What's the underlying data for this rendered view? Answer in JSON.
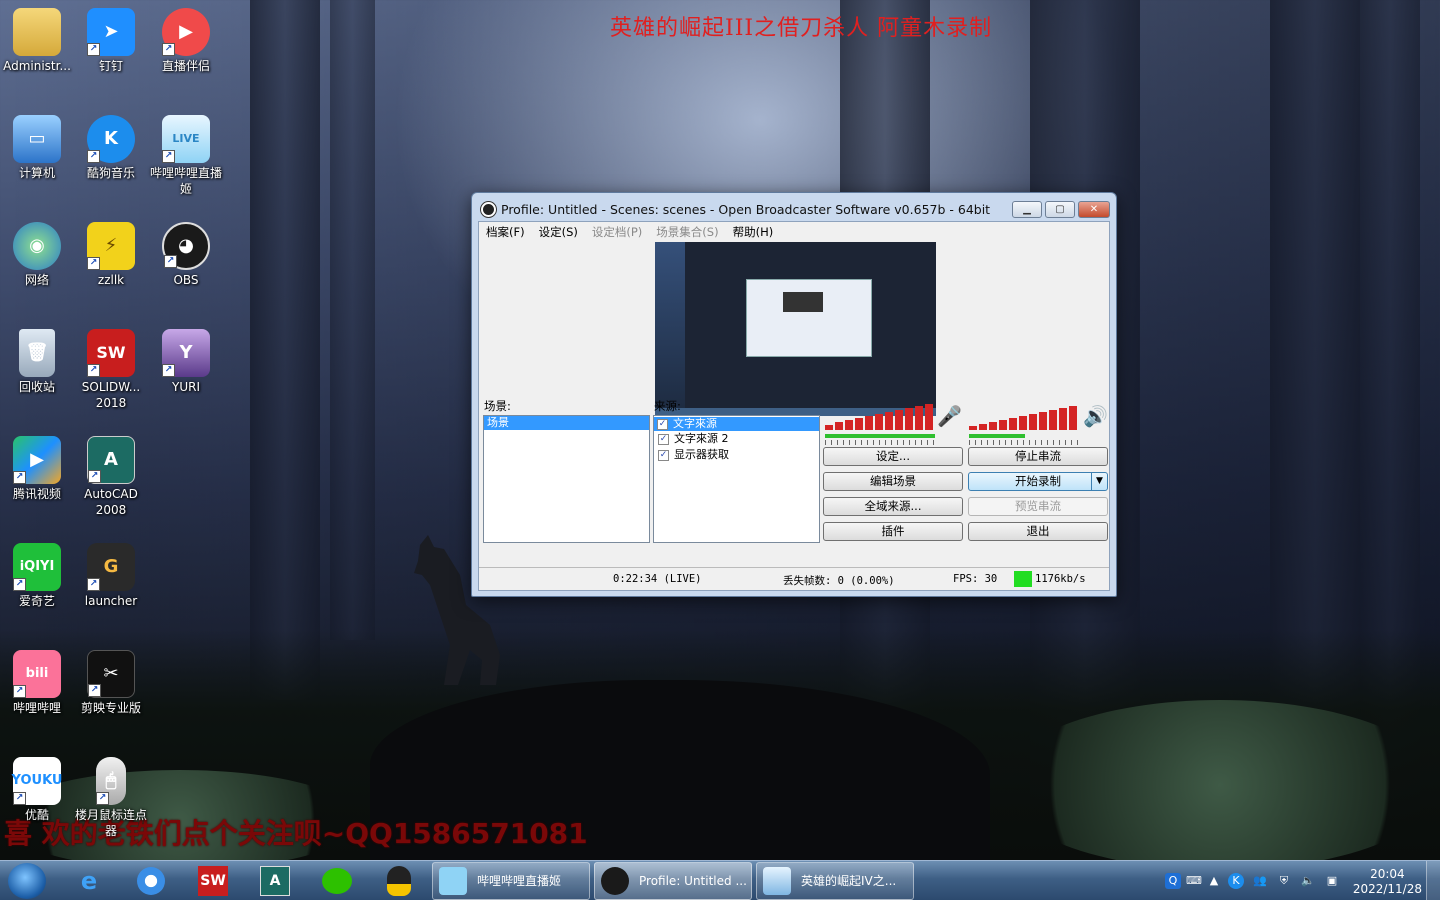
{
  "banner": "英雄的崛起III之借刀杀人   阿童木录制",
  "bottom_text": "喜 欢的老铁们点个关注呗~QQ1586571081",
  "desktop_icons": [
    {
      "label": "Administr..."
    },
    {
      "label": "钉钉"
    },
    {
      "label": "直播伴侣"
    },
    {
      "label": "计算机"
    },
    {
      "label": "酷狗音乐"
    },
    {
      "label": "哔哩哔哩直播姬"
    },
    {
      "label": "网络"
    },
    {
      "label": "zzllk"
    },
    {
      "label": "OBS"
    },
    {
      "label": "回收站"
    },
    {
      "label": "SOLIDW... 2018"
    },
    {
      "label": "YURI"
    },
    {
      "label": "腾讯视频"
    },
    {
      "label": "AutoCAD 2008"
    },
    {
      "label": "爱奇艺"
    },
    {
      "label": "launcher"
    },
    {
      "label": "哔哩哔哩"
    },
    {
      "label": "剪映专业版"
    },
    {
      "label": "优酷"
    },
    {
      "label": "楼月鼠标连点器"
    }
  ],
  "obs": {
    "title": "Profile: Untitled - Scenes: scenes - Open Broadcaster Software v0.657b - 64bit",
    "menu": [
      "档案(F)",
      "设定(S)",
      "设定档(P)",
      "场景集合(S)",
      "帮助(H)"
    ],
    "scenes_label": "场景:",
    "scenes": [
      "场景"
    ],
    "sources_label": "来源:",
    "sources": [
      {
        "name": "文字來源",
        "checked": true
      },
      {
        "name": "文字來源 2",
        "checked": true
      },
      {
        "name": "显示器获取",
        "checked": true
      }
    ],
    "buttons": {
      "settings": "设定...",
      "stop_stream": "停止串流",
      "edit_scene": "编辑场景",
      "start_record": "开始录制",
      "global_sources": "全域来源...",
      "preview_stream": "预览串流",
      "plugins": "插件",
      "exit": "退出"
    },
    "status": {
      "time": "0:22:34 (LIVE)",
      "dropped": "丢失帧数: 0 (0.00%)",
      "fps": "FPS: 30",
      "bitrate": "1176kb/s",
      "bitrate_color": "#22dd22"
    }
  },
  "taskbar": {
    "pinned": [
      "ie-icon",
      "browser-icon",
      "solidworks-icon",
      "autocad-icon",
      "wechat-icon",
      "qq-icon"
    ],
    "tasks": [
      {
        "label": "哔哩哔哩直播姬"
      },
      {
        "label": "Profile: Untitled ..."
      },
      {
        "label": "英雄的崛起IV之..."
      }
    ],
    "clock_time": "20:04",
    "clock_date": "2022/11/28"
  }
}
